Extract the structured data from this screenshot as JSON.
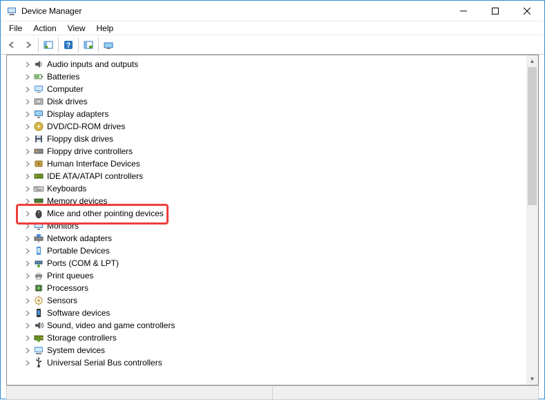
{
  "window": {
    "title": "Device Manager"
  },
  "menu": {
    "file": "File",
    "action": "Action",
    "view": "View",
    "help": "Help"
  },
  "tree": {
    "items": [
      {
        "label": "Audio inputs and outputs",
        "icon": "audio"
      },
      {
        "label": "Batteries",
        "icon": "battery"
      },
      {
        "label": "Computer",
        "icon": "computer"
      },
      {
        "label": "Disk drives",
        "icon": "disk"
      },
      {
        "label": "Display adapters",
        "icon": "display"
      },
      {
        "label": "DVD/CD-ROM drives",
        "icon": "dvd"
      },
      {
        "label": "Floppy disk drives",
        "icon": "floppy"
      },
      {
        "label": "Floppy drive controllers",
        "icon": "floppyctrl"
      },
      {
        "label": "Human Interface Devices",
        "icon": "hid"
      },
      {
        "label": "IDE ATA/ATAPI controllers",
        "icon": "ide"
      },
      {
        "label": "Keyboards",
        "icon": "keyboard"
      },
      {
        "label": "Memory devices",
        "icon": "memory"
      },
      {
        "label": "Mice and other pointing devices",
        "icon": "mouse",
        "highlighted": true
      },
      {
        "label": "Monitors",
        "icon": "monitor"
      },
      {
        "label": "Network adapters",
        "icon": "network"
      },
      {
        "label": "Portable Devices",
        "icon": "portable"
      },
      {
        "label": "Ports (COM & LPT)",
        "icon": "ports"
      },
      {
        "label": "Print queues",
        "icon": "printer"
      },
      {
        "label": "Processors",
        "icon": "cpu"
      },
      {
        "label": "Sensors",
        "icon": "sensor"
      },
      {
        "label": "Software devices",
        "icon": "software"
      },
      {
        "label": "Sound, video and game controllers",
        "icon": "sound"
      },
      {
        "label": "Storage controllers",
        "icon": "storage"
      },
      {
        "label": "System devices",
        "icon": "system"
      },
      {
        "label": "Universal Serial Bus controllers",
        "icon": "usb"
      }
    ]
  },
  "highlight_index": 12,
  "colors": {
    "highlight": "#ef3d3d",
    "border": "#2a8dd4"
  }
}
